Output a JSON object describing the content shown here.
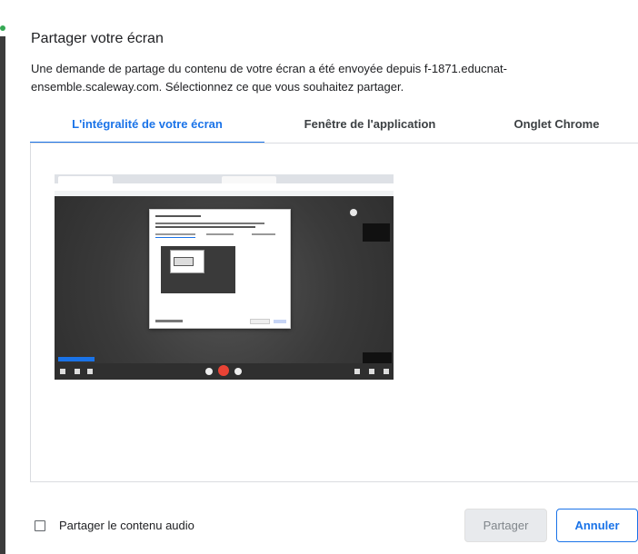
{
  "dialog": {
    "title": "Partager votre écran",
    "description": "Une demande de partage du contenu de votre écran a été envoyée depuis f-1871.educnat-ensemble.scaleway.com. Sélectionnez ce que vous souhaitez partager."
  },
  "tabs": [
    {
      "label": "L'intégralité de votre écran",
      "active": true
    },
    {
      "label": "Fenêtre de l'application",
      "active": false
    },
    {
      "label": "Onglet Chrome",
      "active": false
    }
  ],
  "preview": {
    "selected": false
  },
  "footer": {
    "audio_checkbox_label": "Partager le contenu audio",
    "audio_checked": false,
    "share_label": "Partager",
    "cancel_label": "Annuler"
  },
  "colors": {
    "accent": "#1a73e8",
    "text": "#202124",
    "disabled_bg": "#e8eaed"
  }
}
